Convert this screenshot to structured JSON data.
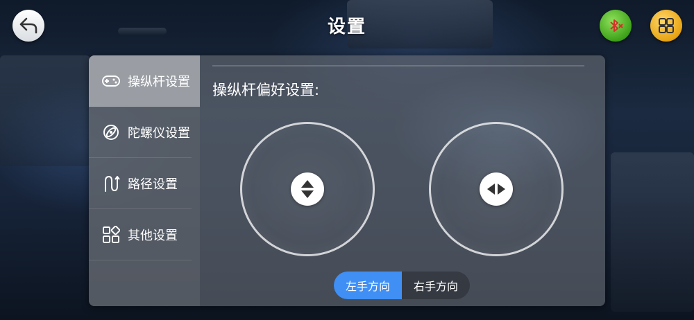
{
  "header": {
    "title": "设置"
  },
  "sidebar": {
    "items": [
      {
        "label": "操纵杆设置",
        "icon": "gamepad-icon",
        "active": true
      },
      {
        "label": "陀螺仪设置",
        "icon": "gyroscope-icon",
        "active": false
      },
      {
        "label": "路径设置",
        "icon": "path-icon",
        "active": false
      },
      {
        "label": "其他设置",
        "icon": "grid-icon",
        "active": false
      }
    ]
  },
  "main": {
    "title": "操纵杆偏好设置:",
    "left_joystick": {
      "icon": "up-down-arrows-icon"
    },
    "right_joystick": {
      "icon": "left-right-arrows-icon"
    },
    "hand_options": [
      {
        "label": "左手方向",
        "selected": true
      },
      {
        "label": "右手方向",
        "selected": false
      }
    ]
  },
  "colors": {
    "accent": "#3f8ff5",
    "bluetooth_button": "#4cb521",
    "menu_button": "#e8a415"
  }
}
